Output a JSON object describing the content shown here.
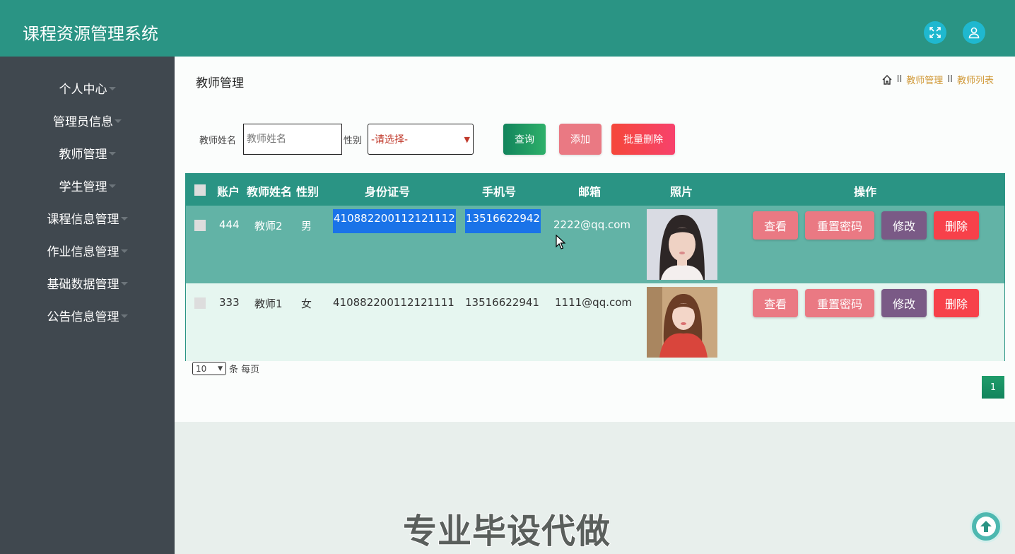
{
  "header": {
    "title": "课程资源管理系统",
    "fullscreen_icon": "expand-icon",
    "user_icon": "user-icon"
  },
  "sidebar": {
    "items": [
      {
        "label": "个人中心"
      },
      {
        "label": "管理员信息"
      },
      {
        "label": "教师管理"
      },
      {
        "label": "学生管理"
      },
      {
        "label": "课程信息管理"
      },
      {
        "label": "作业信息管理"
      },
      {
        "label": "基础数据管理"
      },
      {
        "label": "公告信息管理"
      }
    ]
  },
  "page": {
    "title": "教师管理",
    "breadcrumb": {
      "home_icon": "home-icon",
      "sep": "II",
      "items": [
        "教师管理",
        "教师列表"
      ]
    }
  },
  "search": {
    "name_label": "教师姓名",
    "name_placeholder": "教师姓名",
    "sex_label": "性别",
    "sex_selected": "-请选择-",
    "query_label": "查询",
    "add_label": "添加",
    "batch_delete_label": "批量删除"
  },
  "table": {
    "columns": [
      "账户",
      "教师姓名",
      "性别",
      "身份证号",
      "手机号",
      "邮箱",
      "照片",
      "操作"
    ],
    "rows": [
      {
        "account": "444",
        "name": "教师2",
        "sex": "男",
        "id_no": "410882200112121112",
        "phone": "13516622942",
        "email": "2222@qq.com"
      },
      {
        "account": "333",
        "name": "教师1",
        "sex": "女",
        "id_no": "410882200112121111",
        "phone": "13516622941",
        "email": "1111@qq.com"
      }
    ],
    "actions": {
      "view": "查看",
      "reset": "重置密码",
      "edit": "修改",
      "delete": "删除"
    }
  },
  "pagination": {
    "page_size": "10",
    "page_size_suffix": "条 每页",
    "current_page": "1"
  },
  "watermark": "专业毕设代做",
  "colors": {
    "primary": "#2a9484",
    "sidebar": "#40484f",
    "row_selected": "#62b3a6",
    "row_alt": "#e6f6f0",
    "highlight": "#1a73e8"
  }
}
